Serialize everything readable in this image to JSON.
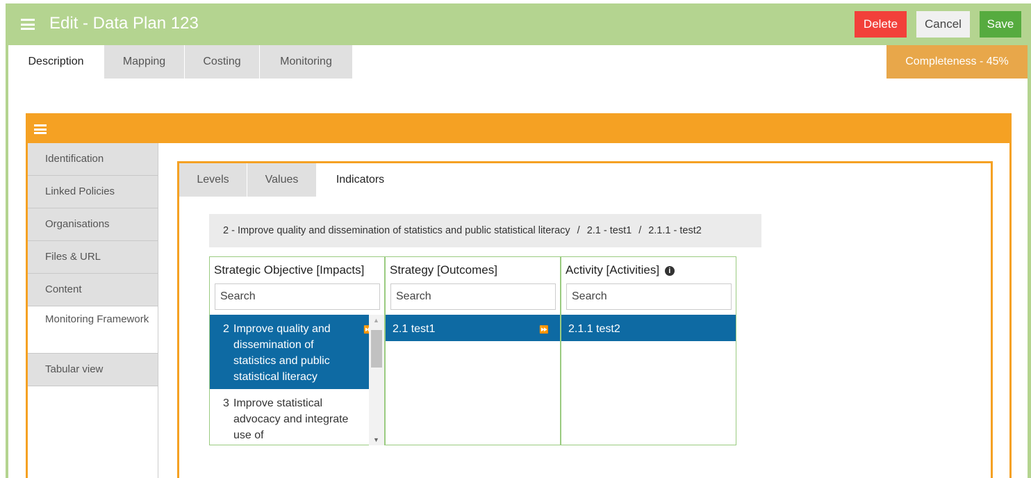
{
  "header": {
    "title": "Edit - Data Plan 123",
    "delete_label": "Delete",
    "cancel_label": "Cancel",
    "save_label": "Save",
    "color": "#b4d490"
  },
  "main_tabs": [
    {
      "label": "Description",
      "active": true
    },
    {
      "label": "Mapping",
      "active": false
    },
    {
      "label": "Costing",
      "active": false
    },
    {
      "label": "Monitoring",
      "active": false
    }
  ],
  "completeness": {
    "label": "Completeness - 45%",
    "value": 45
  },
  "sidebar": {
    "items": [
      {
        "label": "Identification"
      },
      {
        "label": "Linked Policies"
      },
      {
        "label": "Organisations"
      },
      {
        "label": "Files & URL"
      },
      {
        "label": "Content"
      },
      {
        "label": "Monitoring Framework",
        "active": true
      },
      {
        "label": "Tabular view"
      }
    ]
  },
  "sub_tabs": [
    {
      "label": "Levels"
    },
    {
      "label": "Values"
    },
    {
      "label": "Indicators",
      "active": true
    }
  ],
  "breadcrumb": {
    "items": [
      "2 - Improve quality and dissemination of statistics and public statistical literacy",
      "2.1 - test1",
      "2.1.1 - test2"
    ],
    "separator": "/"
  },
  "columns": [
    {
      "title": "Strategic Objective [Impacts]",
      "search_placeholder": "Search",
      "items": [
        {
          "num": "2",
          "text": "Improve quality and dissemination of statistics and public statistical literacy",
          "selected": true
        },
        {
          "num": "3",
          "text": "Improve statistical advocacy and integrate use of",
          "selected": false
        }
      ]
    },
    {
      "title": "Strategy [Outcomes]",
      "search_placeholder": "Search",
      "items": [
        {
          "text": "2.1  test1",
          "selected": true
        }
      ]
    },
    {
      "title": "Activity [Activities]",
      "search_placeholder": "Search",
      "items": [
        {
          "text": "2.1.1  test2",
          "selected": true
        }
      ]
    }
  ],
  "colors": {
    "accent": "#f5a123",
    "selected_row": "#0e6aa3",
    "delete": "#f2403a",
    "save": "#56ab3f"
  }
}
